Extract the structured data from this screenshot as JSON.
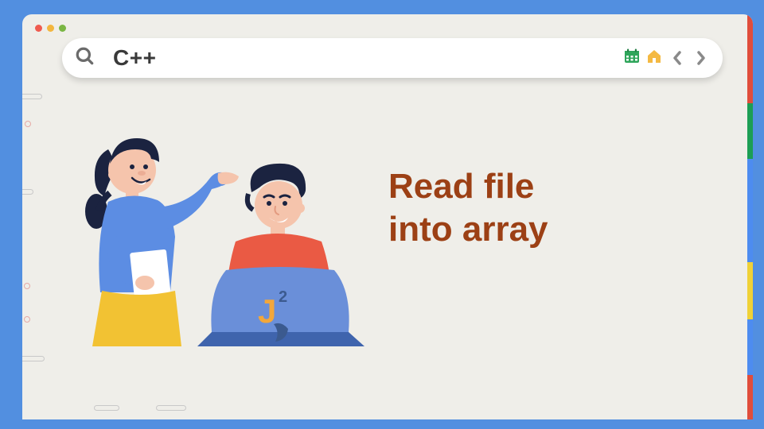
{
  "search": {
    "query": "C++"
  },
  "headline": {
    "line1": "Read file",
    "line2": "into array"
  },
  "colors": {
    "stripe_red": "#e04d3b",
    "stripe_green": "#1c9e55",
    "stripe_blue": "#4d8cf0",
    "stripe_yellow": "#efd137",
    "headline": "#9c4015"
  },
  "icons": {
    "search": "search-icon",
    "calendar": "calendar-icon",
    "home": "home-icon",
    "prev": "chevron-left-icon",
    "next": "chevron-right-icon"
  },
  "illustration": {
    "logo_text": "J",
    "logo_superscript": "2"
  }
}
